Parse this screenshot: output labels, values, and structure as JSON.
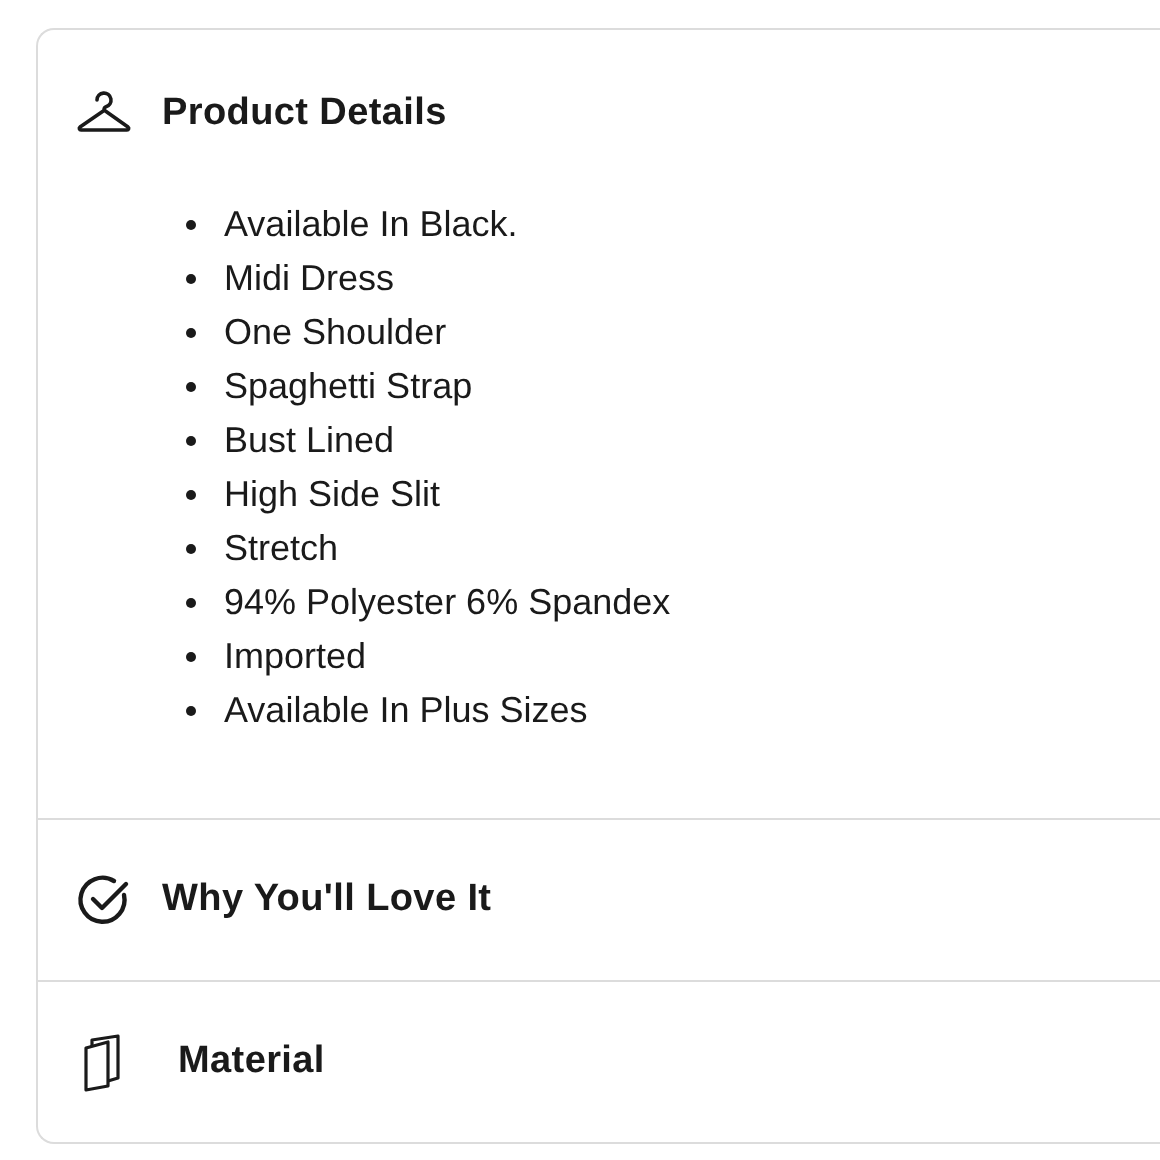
{
  "sections": [
    {
      "kind": "hanger",
      "title": "Product Details",
      "items": [
        "Available In Black.",
        "Midi Dress",
        "One Shoulder",
        "Spaghetti Strap",
        "Bust Lined",
        "High Side Slit",
        "Stretch",
        "94% Polyester 6% Spandex",
        "Imported",
        "Available In Plus Sizes"
      ]
    },
    {
      "kind": "check",
      "title": "Why You'll Love It"
    },
    {
      "kind": "fabric",
      "title": "Material"
    }
  ]
}
